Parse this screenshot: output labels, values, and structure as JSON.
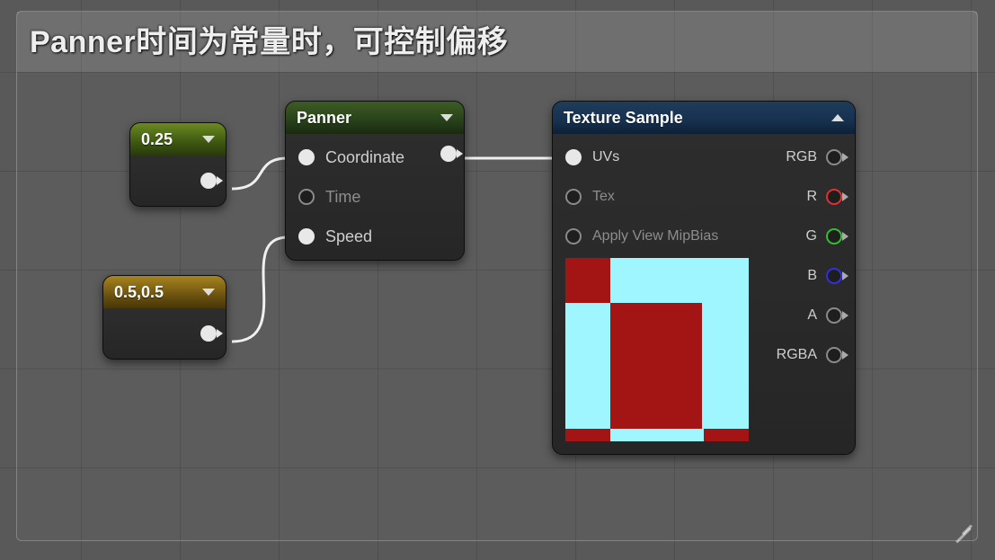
{
  "comment": {
    "title": "Panner时间为常量时，可控制偏移"
  },
  "constants": {
    "c1": {
      "value": "0.25"
    },
    "c2": {
      "value": "0.5,0.5"
    }
  },
  "panner": {
    "title": "Panner",
    "inputs": {
      "coordinate": "Coordinate",
      "time": "Time",
      "speed": "Speed"
    }
  },
  "texsample": {
    "title": "Texture Sample",
    "inputs": {
      "uvs": "UVs",
      "tex": "Tex",
      "mipbias": "Apply View MipBias"
    },
    "outputs": {
      "rgb": "RGB",
      "r": "R",
      "g": "G",
      "b": "B",
      "a": "A",
      "rgba": "RGBA"
    }
  }
}
